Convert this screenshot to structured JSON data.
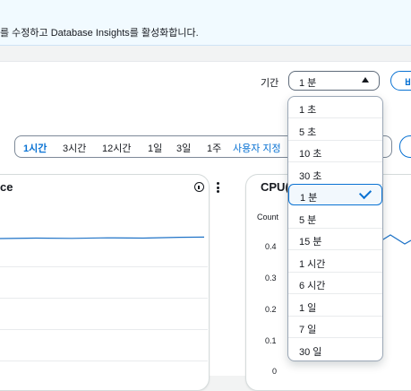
{
  "banner": {
    "text": "를 수정하고 Database Insights를 활성화합니다."
  },
  "period": {
    "label": "기간",
    "selected": "1 분",
    "right_button": "비",
    "options": [
      "1 초",
      "5 초",
      "10 초",
      "30 초",
      "1 분",
      "5 분",
      "15 분",
      "1 시간",
      "6 시간",
      "1 일",
      "7 일",
      "30 일"
    ],
    "selected_index": 4
  },
  "range": {
    "items": [
      "1시간",
      "3시간",
      "12시간",
      "1일",
      "3일",
      "1주",
      "사용자 지정"
    ],
    "active_index": 0
  },
  "left_card": {
    "title": "ce"
  },
  "right_card": {
    "title": "CPU(",
    "count_label": "Count",
    "yticks": [
      "0.4",
      "0.3",
      "0.2",
      "0.1",
      "0"
    ]
  },
  "colors": {
    "accent": "#0972d3",
    "line": "#1f73c7"
  }
}
